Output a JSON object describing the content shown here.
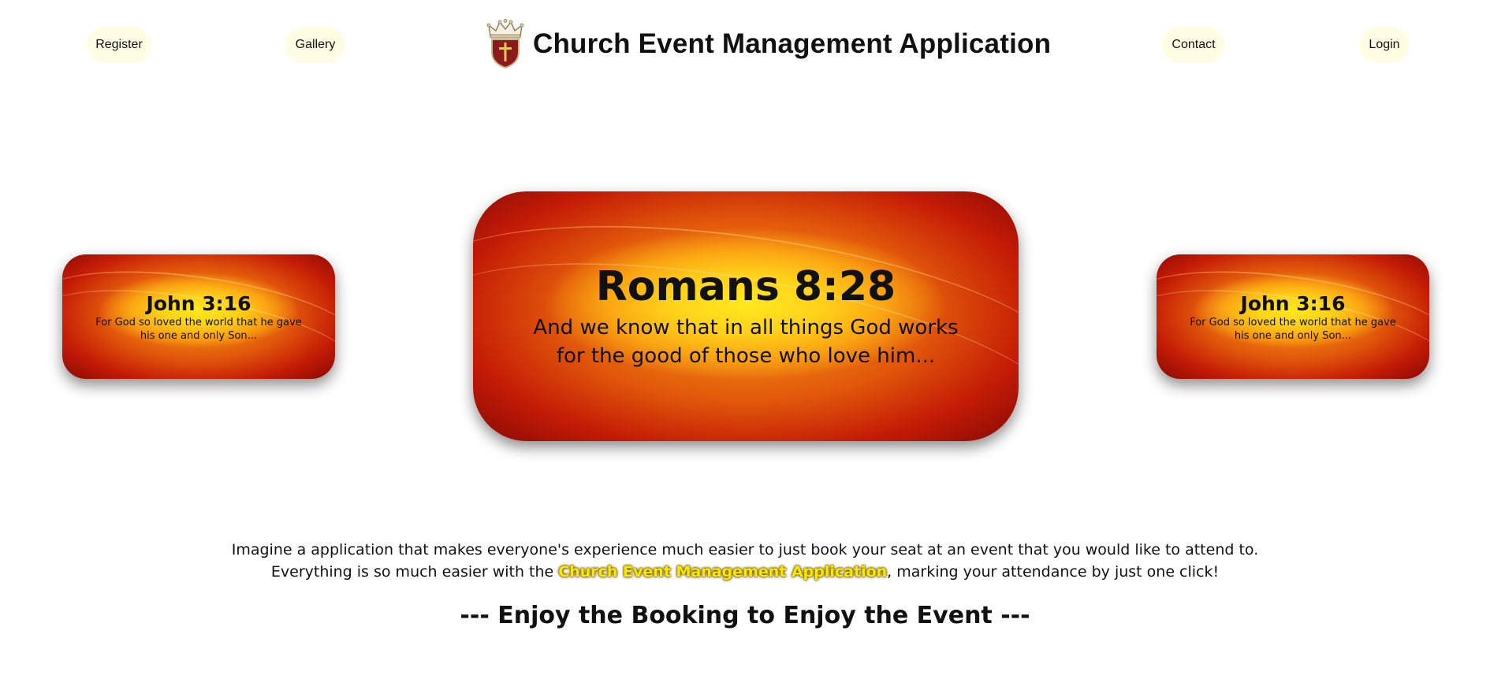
{
  "header": {
    "title": "Church Event Management Application",
    "logo_icon": "crown-shield-cross-icon",
    "nav": {
      "register": "Register",
      "gallery": "Gallery",
      "contact": "Contact",
      "login": "Login"
    }
  },
  "verses": {
    "left": {
      "reference": "John 3:16",
      "text": "For God so loved the world that he gave his one and only Son..."
    },
    "center": {
      "reference": "Romans 8:28",
      "text": "And we know that in all things God works for the good of those who love him..."
    },
    "right": {
      "reference": "John 3:16",
      "text": "For God so loved the world that he gave his one and only Son..."
    }
  },
  "intro": {
    "line1": "Imagine a application that makes everyone's experience much easier to just book your seat at an event that you would like to attend to.",
    "line2_before": "Everything is so much easier with the ",
    "line2_highlight": "Church Event Management Application",
    "line2_after": ", marking your attendance by just one click!"
  },
  "tagline": "--- Enjoy the Booking to Enjoy the Event ---",
  "colors": {
    "nav_pill": "#fffde3",
    "card_center": "#ffe81f",
    "card_edge": "#8a0a05",
    "highlight": "#ffe800"
  }
}
